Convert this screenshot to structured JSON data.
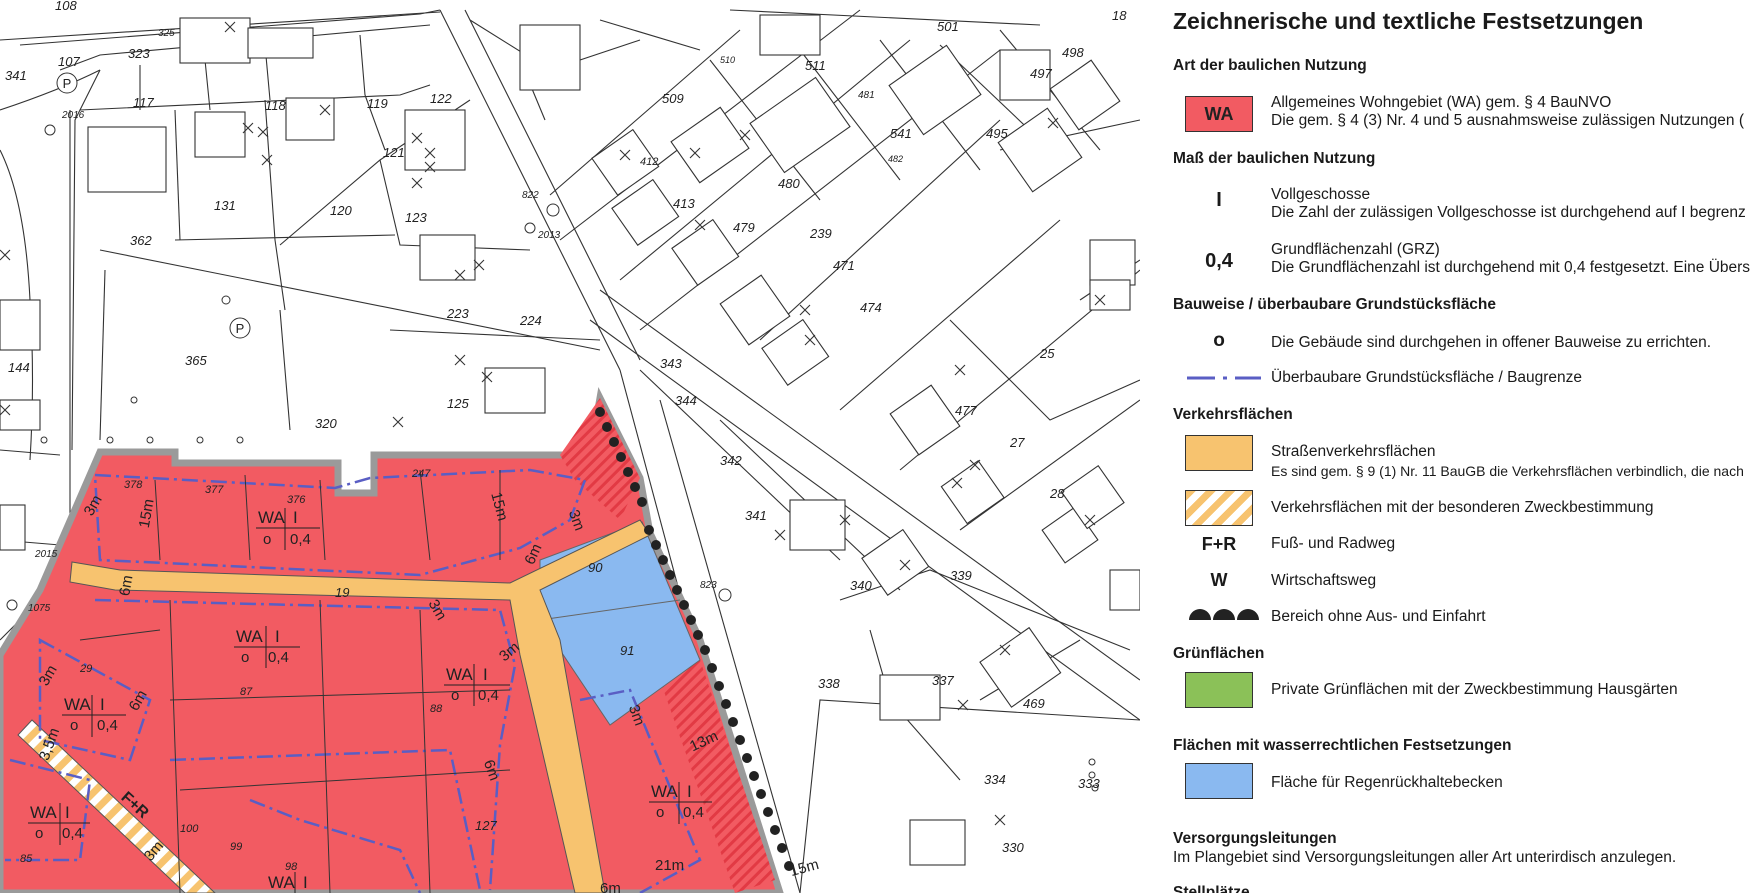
{
  "legend": {
    "title": "Zeichnerische und textliche Festsetzungen",
    "art": {
      "heading": "Art der baulichen Nutzung",
      "wa_symbol": "WA",
      "wa_line1": "Allgemeines Wohngebiet (WA) gem. § 4 BauNVO",
      "wa_line2": "Die gem. § 4 (3) Nr. 4 und 5 ausnahmsweise zulässigen Nutzungen ("
    },
    "mass": {
      "heading": "Maß der baulichen Nutzung",
      "vg_symbol": "I",
      "vg_line1": "Vollgeschosse",
      "vg_line2": "Die Zahl der zulässigen Vollgeschosse ist durchgehend auf I begrenz",
      "grz_symbol": "0,4",
      "grz_line1": "Grundflächenzahl (GRZ)",
      "grz_line2": "Die Grundflächenzahl ist durchgehend mit 0,4 festgesetzt. Eine Übers"
    },
    "bauweise": {
      "heading": "Bauweise / überbaubare Grundstücksfläche",
      "o_symbol": "o",
      "o_text": "Die Gebäude sind durchgehen in offener Bauweise zu errichten.",
      "baugrenze_text": "Überbaubare Grundstücksfläche / Baugrenze"
    },
    "verkehr": {
      "heading": "Verkehrsflächen",
      "strasse_line1": "Straßenverkehrsflächen",
      "strasse_line2": "Es sind gem. § 9 (1) Nr. 11 BauGB die Verkehrsflächen verbindlich, die nach",
      "besondere_text": "Verkehrsflächen mit der besonderen Zweckbestimmung",
      "fr_symbol": "F+R",
      "fr_text": "Fuß- und Radweg",
      "w_symbol": "W",
      "w_text": "Wirtschaftsweg",
      "ohne_text": "Bereich ohne Aus- und Einfahrt"
    },
    "gruen": {
      "heading": "Grünflächen",
      "text": "Private Grünflächen mit der Zweckbestimmung Hausgärten"
    },
    "wasser": {
      "heading": "Flächen mit wasserrechtlichen Festsetzungen",
      "text": "Fläche für Regenrückhaltebecken"
    },
    "versorgung": {
      "heading": "Versorgungsleitungen",
      "text": "Im Plangebiet sind Versorgungsleitungen aller Art unterirdisch anzulegen."
    },
    "stellplaetze": {
      "heading": "Stellplätze"
    }
  },
  "map": {
    "parcels": [
      "108",
      "323",
      "325",
      "107",
      "341",
      "117",
      "2016",
      "118",
      "119",
      "122",
      "121",
      "131",
      "120",
      "362",
      "123",
      "822",
      "2013",
      "223",
      "224",
      "365",
      "144",
      "125",
      "320",
      "509",
      "511",
      "501",
      "498",
      "497",
      "510",
      "481",
      "541",
      "495",
      "480",
      "482",
      "413",
      "412",
      "479",
      "239",
      "471",
      "474",
      "25",
      "343",
      "344",
      "477",
      "27",
      "342",
      "28",
      "341",
      "340",
      "339",
      "823",
      "338",
      "337",
      "469",
      "334",
      "333",
      "330",
      "18",
      "2015",
      "1075",
      "378",
      "377",
      "376",
      "247",
      "90",
      "91",
      "85",
      "100",
      "99",
      "98",
      "127",
      "88",
      "87",
      "29"
    ],
    "wa_label": "WA",
    "geschoss": "I",
    "bauweise": "o",
    "grz": "0,4",
    "road_label_19": "19",
    "fr_label": "F+R",
    "dimensions": [
      "15m",
      "3m",
      "6m",
      "5m",
      "13m",
      "21m",
      "3,5m"
    ]
  },
  "colors": {
    "wohngebiet": "#f25b62",
    "strasse": "#f7c36f",
    "gruen": "#8bc158",
    "wasser": "#8ab9f0",
    "baugrenze": "#5a5ec4",
    "boundary": "#9a9a9a"
  },
  "icons": [
    "parking-icon",
    "ohne-ausfahrt-dots-icon",
    "striped-pattern-icon"
  ]
}
